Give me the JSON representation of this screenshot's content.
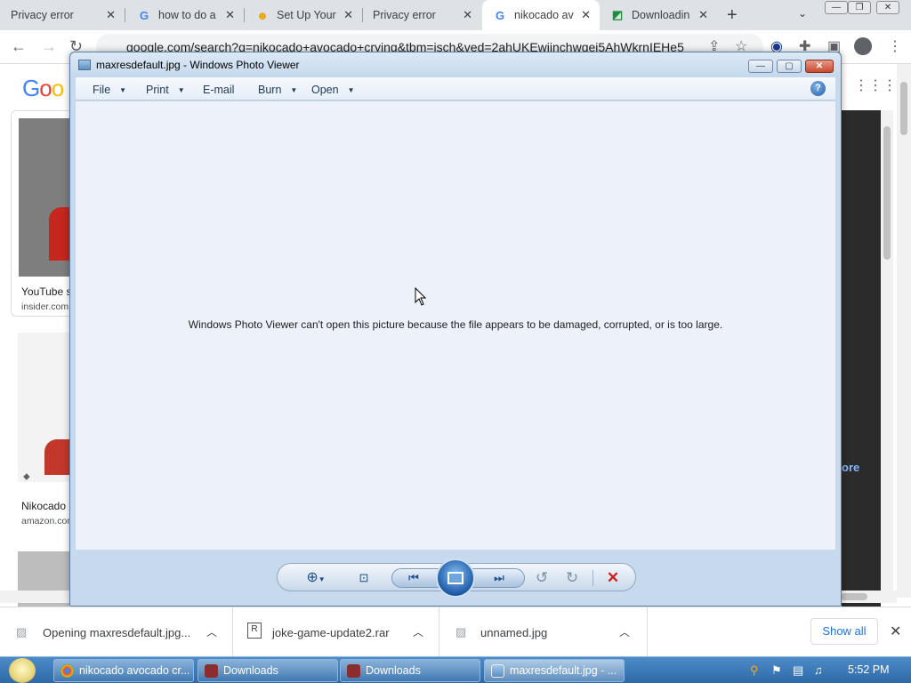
{
  "browser": {
    "tabs": [
      {
        "title": "Privacy error",
        "icon": "privacy-error-icon"
      },
      {
        "title": "how to do a",
        "icon": "google-g-icon"
      },
      {
        "title": "Set Up Your",
        "icon": "emoji-face-icon"
      },
      {
        "title": "Privacy error",
        "icon": "privacy-error-icon"
      },
      {
        "title": "nikocado av",
        "icon": "google-g-icon",
        "active": true
      },
      {
        "title": "Downloadin",
        "icon": "download-page-icon"
      }
    ],
    "address": "google.com/search?q=nikocado+avocado+crying&tbm=isch&ved=2ahUKEwiinchwgei5AhWkrnIEHe5",
    "accent": "#1a73e8"
  },
  "google_page": {
    "logo_text": "Goo",
    "results": [
      {
        "title": "YouTube s",
        "source": "insider.com"
      },
      {
        "title": "Nikocado",
        "source": "amazon.com"
      }
    ],
    "right_fragment": "ore"
  },
  "photo_viewer": {
    "title": "maxresdefault.jpg - Windows Photo Viewer",
    "controls": {
      "minimize": "—",
      "maximize": "▢",
      "close": "✕"
    },
    "menu": [
      {
        "label": "File",
        "has_arrow": true
      },
      {
        "label": "Print",
        "has_arrow": true
      },
      {
        "label": "E-mail",
        "has_arrow": false
      },
      {
        "label": "Burn",
        "has_arrow": true
      },
      {
        "label": "Open",
        "has_arrow": true
      }
    ],
    "help": "?",
    "message": "Windows Photo Viewer can't open this picture because the file appears to be damaged, corrupted, or is too large.",
    "toolbar": {
      "zoom": "⊕",
      "actual_size": "⊡",
      "previous": "⏮",
      "next": "⏭",
      "rotate_ccw": "↺",
      "rotate_cw": "↻",
      "delete": "✕"
    }
  },
  "downloads": {
    "items": [
      {
        "name": "Opening maxresdefault.jpg...",
        "icon": "image-file-icon"
      },
      {
        "name": "joke-game-update2.rar",
        "icon": "rar-archive-icon"
      },
      {
        "name": "unnamed.jpg",
        "icon": "image-file-icon"
      }
    ],
    "show_all": "Show all"
  },
  "taskbar": {
    "tasks": [
      {
        "label": "nikocado avocado cr...",
        "icon": "chrome-icon"
      },
      {
        "label": "Downloads",
        "icon": "folder-app-icon"
      },
      {
        "label": "Downloads",
        "icon": "folder-app-icon"
      },
      {
        "label": "maxresdefault.jpg - ...",
        "icon": "photo-viewer-icon",
        "active": true
      }
    ],
    "clock": "5:52 PM"
  }
}
